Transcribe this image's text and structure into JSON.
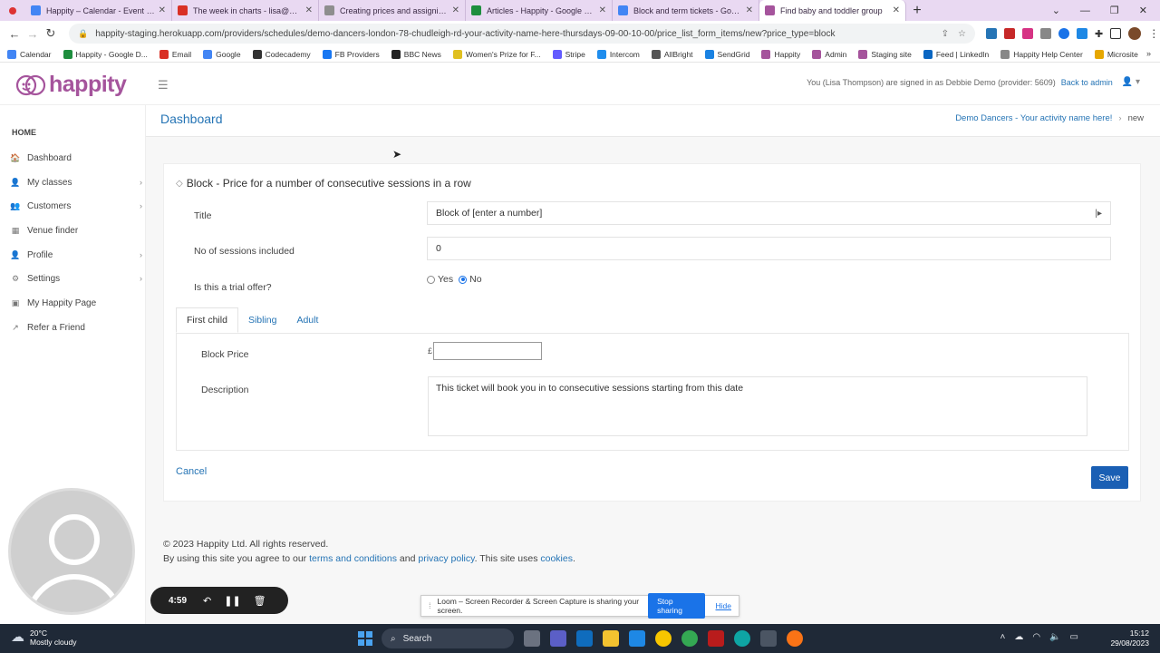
{
  "browser": {
    "tabs": [
      {
        "title": "Happity – Calendar - Event detai",
        "color": "#4285f4"
      },
      {
        "title": "The week in charts - lisa@happit",
        "color": "#d93025"
      },
      {
        "title": "Creating prices and assigning tic",
        "color": "#8e8e8e"
      },
      {
        "title": "Articles - Happity - Google Drive",
        "color": "#1e8e3e"
      },
      {
        "title": "Block and term tickets - Google D",
        "color": "#4285f4"
      },
      {
        "title": "Find baby and toddler group",
        "color": "#a5549c"
      }
    ],
    "url": "happity-staging.herokuapp.com/providers/schedules/demo-dancers-london-78-chudleigh-rd-your-activity-name-here-thursdays-09-00-10-00/price_list_form_items/new?price_type=block",
    "bookmarks": [
      {
        "label": "Calendar",
        "color": "#4285f4"
      },
      {
        "label": "Happity - Google D...",
        "color": "#1e8e3e"
      },
      {
        "label": "Email",
        "color": "#d93025"
      },
      {
        "label": "Google",
        "color": "#4285f4"
      },
      {
        "label": "Codecademy",
        "color": "#333333"
      },
      {
        "label": "FB Providers",
        "color": "#1877f2"
      },
      {
        "label": "BBC News",
        "color": "#222222"
      },
      {
        "label": "Women's Prize for F...",
        "color": "#e0c020"
      },
      {
        "label": "Stripe",
        "color": "#635bff"
      },
      {
        "label": "Intercom",
        "color": "#1f8ded"
      },
      {
        "label": "AllBright",
        "color": "#555555"
      },
      {
        "label": "SendGrid",
        "color": "#1a82e2"
      },
      {
        "label": "Happity",
        "color": "#a5549c"
      },
      {
        "label": "Admin",
        "color": "#a5549c"
      },
      {
        "label": "Staging site",
        "color": "#a5549c"
      },
      {
        "label": "Feed | LinkedIn",
        "color": "#0a66c2"
      },
      {
        "label": "Happity Help Center",
        "color": "#888888"
      },
      {
        "label": "Microsite",
        "color": "#e6a700"
      }
    ]
  },
  "app": {
    "logo_text": "happity",
    "signed_in_text": "You (Lisa Thompson) are signed in as Debbie Demo (provider: 5609)",
    "back_to_admin": "Back to admin"
  },
  "sidebar": {
    "home_label": "HOME",
    "items": [
      {
        "label": "Dashboard",
        "icon": "🏠",
        "has_children": false
      },
      {
        "label": "My classes",
        "icon": "👤",
        "has_children": true
      },
      {
        "label": "Customers",
        "icon": "👥",
        "has_children": true
      },
      {
        "label": "Venue finder",
        "icon": "▦",
        "has_children": false
      },
      {
        "label": "Profile",
        "icon": "👤",
        "has_children": true
      },
      {
        "label": "Settings",
        "icon": "⚙",
        "has_children": true
      },
      {
        "label": "My Happity Page",
        "icon": "▣",
        "has_children": false
      },
      {
        "label": "Refer a Friend",
        "icon": "↗",
        "has_children": false
      }
    ]
  },
  "page": {
    "title": "Dashboard",
    "breadcrumb_link": "Demo Dancers - Your activity name here!",
    "breadcrumb_current": "new"
  },
  "form": {
    "heading": "Block - Price for a number of consecutive sessions in a row",
    "title_label": "Title",
    "title_value": "Block of [enter a number]",
    "sessions_label": "No of sessions included",
    "sessions_value": "0",
    "trial_label": "Is this a trial offer?",
    "trial_yes": "Yes",
    "trial_no": "No",
    "trial_selected": "No",
    "tabs": [
      "First child",
      "Sibling",
      "Adult"
    ],
    "active_tab": "First child",
    "block_price_label": "Block Price",
    "currency": "£",
    "block_price_value": "",
    "description_label": "Description",
    "description_value": "This ticket will book you in to consecutive sessions starting from this date",
    "cancel_label": "Cancel",
    "save_label": "Save"
  },
  "footer": {
    "copyright": "© 2023 Happity Ltd. All rights reserved.",
    "agree_prefix": "By using this site you agree to our",
    "terms_link": "terms and conditions",
    "and_text": "and",
    "privacy_link": "privacy policy",
    "uses_text": ". This site uses",
    "cookies_link": "cookies",
    "end_text": "."
  },
  "loom": {
    "timer": "4:59",
    "share_text": "Loom – Screen Recorder & Screen Capture is sharing your screen.",
    "stop_sharing": "Stop sharing",
    "hide": "Hide"
  },
  "taskbar": {
    "temperature": "20°C",
    "weather": "Mostly cloudy",
    "search_label": "Search",
    "time": "15:12",
    "date": "29/08/2023"
  },
  "colors": {
    "brand": "#a5549c",
    "link": "#2574b5",
    "primary_button": "#1a5fb4"
  }
}
